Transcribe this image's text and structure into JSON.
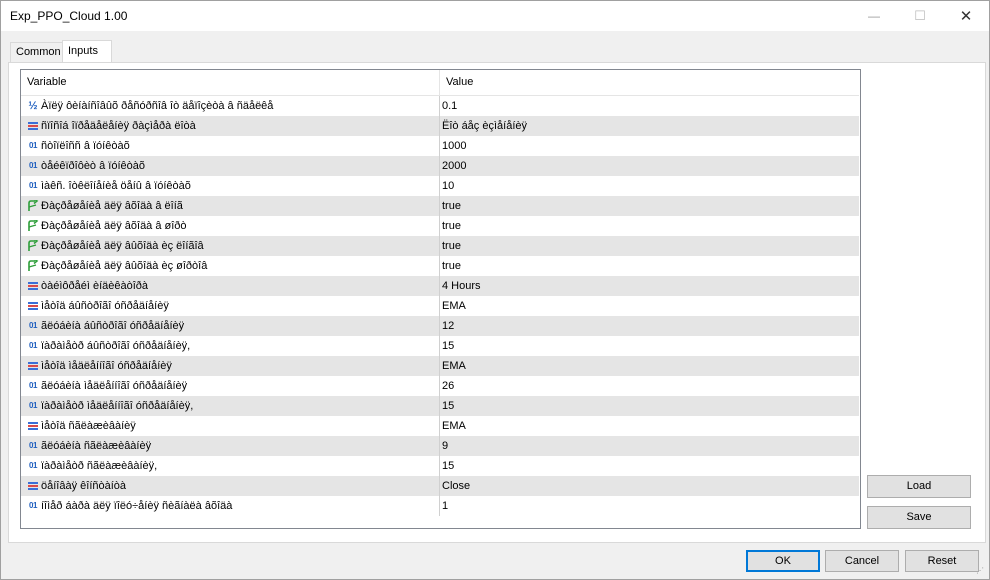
{
  "window": {
    "title": "Exp_PPO_Cloud 1.00",
    "controls": {
      "minimize": "—",
      "maximize": "☐",
      "close": "✕"
    }
  },
  "tabs": [
    {
      "label": "Common",
      "active": false
    },
    {
      "label": "Inputs",
      "active": true
    }
  ],
  "grid": {
    "columns": {
      "variable": "Variable",
      "value": "Value"
    },
    "rows": [
      {
        "icon": "double",
        "name": "Àïëÿ ôèíàíñîâûõ ðåñóðñîâ îò äåïîçèòà â ñäåëêå",
        "value": "0.1"
      },
      {
        "icon": "enum",
        "name": "ñïîñîá îïðåäåëåíèÿ ðàçìåðà ëîòà",
        "value": "Ëîò áåç èçìåíåíèÿ"
      },
      {
        "icon": "int",
        "name": "ñòîïëîññ â ïóíêòàõ",
        "value": "1000"
      },
      {
        "icon": "int",
        "name": "òåéêïðîôèò â ïóíêòàõ",
        "value": "2000"
      },
      {
        "icon": "int",
        "name": "ìàêñ. îòêëîíåíèå öåíû â ïóíêòàõ",
        "value": "10"
      },
      {
        "icon": "bool",
        "name": "Ðàçðåøåíèå äëÿ âõîäà â ëîíã",
        "value": "true"
      },
      {
        "icon": "bool",
        "name": "Ðàçðåøåíèå äëÿ âõîäà â øîðò",
        "value": "true"
      },
      {
        "icon": "bool",
        "name": "Ðàçðåøåíèå äëÿ âûõîäà èç ëîíãîâ",
        "value": "true"
      },
      {
        "icon": "bool",
        "name": "Ðàçðåøåíèå äëÿ âûõîäà èç øîðòîâ",
        "value": "true"
      },
      {
        "icon": "enum",
        "name": "òàéìôðåéì èíäèêàòîðà",
        "value": "4 Hours"
      },
      {
        "icon": "enum",
        "name": "ìåòîä áûñòðîãî óñðåäíåíèÿ",
        "value": "EMA"
      },
      {
        "icon": "int",
        "name": "ãëóáèíà áûñòðîãî óñðåäíåíèÿ",
        "value": "12"
      },
      {
        "icon": "int",
        "name": "ïàðàìåòð áûñòðîãî óñðåäíåíèÿ,",
        "value": "15"
      },
      {
        "icon": "enum",
        "name": "ìåòîä ìåäëåííîãî óñðåäíåíèÿ",
        "value": "EMA"
      },
      {
        "icon": "int",
        "name": "ãëóáèíà ìåäëåííîãî óñðåäíåíèÿ",
        "value": "26"
      },
      {
        "icon": "int",
        "name": "ïàðàìåòð ìåäëåííîãî óñðåäíåíèÿ,",
        "value": "15"
      },
      {
        "icon": "enum",
        "name": "ìåòîä ñãëàæèâàíèÿ",
        "value": "EMA"
      },
      {
        "icon": "int",
        "name": "ãëóáèíà ñãëàæèâàíèÿ",
        "value": "9"
      },
      {
        "icon": "int",
        "name": "ïàðàìåòð ñãëàæèâàíèÿ,",
        "value": "15"
      },
      {
        "icon": "enum",
        "name": "öåíîâàÿ êîíñòàíòà",
        "value": "Close"
      },
      {
        "icon": "int",
        "name": "íîìåð áàðà äëÿ ïîëó÷åíèÿ ñèãíàëà âõîäà",
        "value": "1"
      }
    ]
  },
  "side_buttons": {
    "load": "Load",
    "save": "Save"
  },
  "bottom_buttons": {
    "ok": "OK",
    "cancel": "Cancel",
    "reset": "Reset"
  },
  "icons": {
    "int": "01",
    "double": "½"
  },
  "colors": {
    "icon_blue": "#1f5fbf",
    "enum_top": "#3a6fd8",
    "enum_mid": "#d84a4a",
    "bool_green": "#2e9e3a",
    "alt_row": "#e5e5e5",
    "primary_border": "#0078d7"
  }
}
